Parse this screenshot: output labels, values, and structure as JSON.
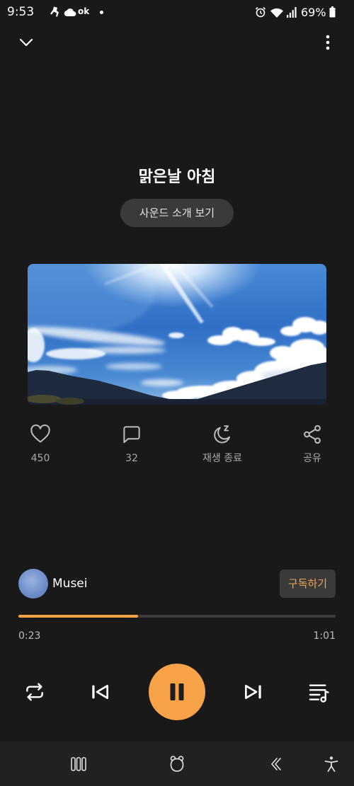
{
  "status_bar": {
    "time": "9:53",
    "notification_text": "ok",
    "battery_text": "69%",
    "icons": [
      "app-notification-icon",
      "cloud-icon",
      "alarm-icon",
      "wifi-icon",
      "signal-icon",
      "battery-icon"
    ]
  },
  "header": {
    "icons": [
      "chevron-down-icon",
      "more-vertical-icon"
    ]
  },
  "track": {
    "title": "맑은날 아침",
    "intro_button_label": "사운드 소개 보기"
  },
  "actions": [
    {
      "icon": "heart-icon",
      "label": "450"
    },
    {
      "icon": "comment-icon",
      "label": "32"
    },
    {
      "icon": "sleep-timer-icon",
      "label": "재생 종료"
    },
    {
      "icon": "share-icon",
      "label": "공유"
    }
  ],
  "artist": {
    "name": "Musei",
    "subscribe_label": "구독하기"
  },
  "player": {
    "progress": 0.377,
    "elapsed": "0:23",
    "duration": "1:01",
    "controls": [
      "repeat-icon",
      "previous-icon",
      "pause-icon",
      "next-icon",
      "playlist-icon"
    ]
  },
  "nav_bar": {
    "icons": [
      "recent-apps-icon",
      "home-icon",
      "back-icon",
      "accessibility-icon"
    ]
  },
  "colors": {
    "accent": "#f8a348",
    "background": "#191919",
    "surface": "#3a3a3a"
  }
}
